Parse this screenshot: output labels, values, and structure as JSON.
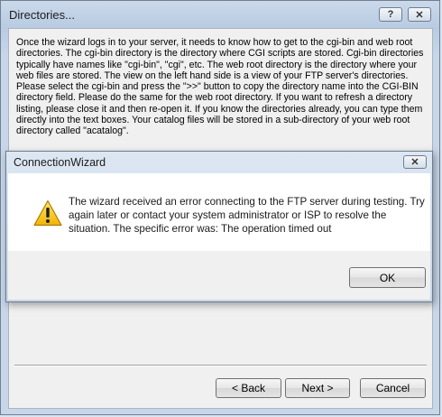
{
  "outer_window": {
    "title": "Directories...",
    "help_button": "?",
    "close_button": "✕",
    "description": "Once the wizard logs in to your server, it needs to know how to get to the cgi-bin and web root directories.  The cgi-bin directory is the directory where CGI scripts are stored.  Cgi-bin directories typically have names like \"cgi-bin\", \"cgi\", etc.  The web root directory is the directory where your web files are stored.   The view on the left hand side is a view of your FTP server's directories.  Please select the cgi-bin and press the \">>\" button to copy the directory name into the CGI-BIN directory field.  Please do the same for the web root directory.  If you want to refresh a directory listing, please close it and then re-open it.  If you know the directories already, you can type them directly into the text boxes.  Your catalog files will be stored in a sub-directory of your web root directory called \"acatalog\".",
    "buttons": {
      "back": "< Back",
      "next": "Next >",
      "cancel": "Cancel"
    }
  },
  "dialog": {
    "title": "ConnectionWizard",
    "close_button": "✕",
    "icon": "warning-icon",
    "message": "The wizard received an error connecting to the FTP server during testing.  Try again later or contact your system administrator or ISP to resolve the situation.  The specific error was: The operation timed out",
    "ok_label": "OK"
  }
}
